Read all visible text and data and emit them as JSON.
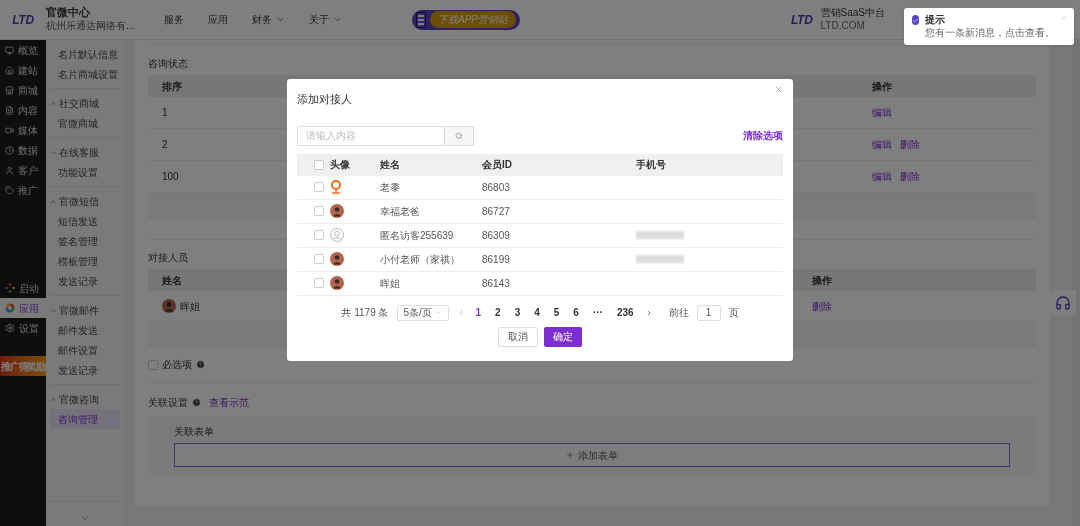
{
  "topbar": {
    "logo": "LTD",
    "title": "官微中心",
    "subtitle": "杭州乐通达网络有...",
    "nav": [
      {
        "label": "服务",
        "dropdown": false
      },
      {
        "label": "应用",
        "dropdown": false
      },
      {
        "label": "财务",
        "dropdown": true
      },
      {
        "label": "关于",
        "dropdown": true
      }
    ],
    "banner": "下载APP营销站",
    "brand": {
      "logo": "LTD",
      "name": "营销SaaS中台",
      "domain": "LTD.COM"
    }
  },
  "main_nav": [
    {
      "label": "概览",
      "selected": false
    },
    {
      "label": "建站",
      "selected": false
    },
    {
      "label": "商城",
      "selected": false
    },
    {
      "label": "内容",
      "selected": false
    },
    {
      "label": "媒体",
      "selected": false
    },
    {
      "label": "数据",
      "selected": false
    },
    {
      "label": "客户",
      "selected": false
    },
    {
      "label": "推广",
      "selected": false
    }
  ],
  "main_nav_bottom": [
    {
      "label": "启动",
      "selected": false
    },
    {
      "label": "应用",
      "selected": true
    },
    {
      "label": "设置",
      "selected": false
    }
  ],
  "promo": "推广得奖励",
  "sub_nav": [
    {
      "items": [
        {
          "label": "名片默认信息",
          "selected": false
        },
        {
          "label": "名片商城设置",
          "selected": false
        }
      ]
    },
    {
      "title": "社交商城",
      "expanded": true,
      "items": [
        {
          "label": "官微商城",
          "selected": false
        }
      ]
    },
    {
      "title": "在线客服",
      "expanded": true,
      "items": [
        {
          "label": "功能设置",
          "selected": false
        }
      ]
    },
    {
      "title": "官微短信",
      "expanded": true,
      "items": [
        {
          "label": "短信发送",
          "selected": false
        },
        {
          "label": "签名管理",
          "selected": false
        },
        {
          "label": "模板管理",
          "selected": false
        },
        {
          "label": "发送记录",
          "selected": false
        }
      ]
    },
    {
      "title": "官微邮件",
      "expanded": true,
      "items": [
        {
          "label": "邮件发送",
          "selected": false
        },
        {
          "label": "邮件设置",
          "selected": false
        },
        {
          "label": "发送记录",
          "selected": false
        }
      ]
    },
    {
      "title": "官微咨询",
      "expanded": true,
      "items": [
        {
          "label": "咨询管理",
          "selected": true
        }
      ]
    }
  ],
  "status_section": {
    "title": "咨询状态",
    "columns": [
      "排序",
      "操作"
    ],
    "rows": [
      {
        "order": "1",
        "actions": [
          "编辑"
        ]
      },
      {
        "order": "2",
        "actions": [
          "编辑",
          "删除"
        ]
      },
      {
        "order": "100",
        "actions": [
          "编辑",
          "删除"
        ]
      }
    ]
  },
  "contacts_section": {
    "title": "对接人员",
    "columns": [
      "姓名",
      "操作"
    ],
    "rows": [
      {
        "name": "晖姐",
        "actions": [
          "删除"
        ]
      }
    ]
  },
  "required": {
    "label": "必选项",
    "checked": false
  },
  "link_settings": {
    "title": "关联设置",
    "example_link": "查看示范",
    "form_label": "关联表单",
    "add_button": "添加表单"
  },
  "dialog": {
    "title": "添加对接人",
    "search_placeholder": "请输入内容",
    "clear_link": "清除选项",
    "all_checked": false,
    "columns": [
      "头像",
      "姓名",
      "会员ID",
      "手机号"
    ],
    "rows": [
      {
        "kind": "pin",
        "name": "老黍",
        "id": "86803",
        "checked": false,
        "phone_blurred": false
      },
      {
        "kind": "photo",
        "name": "幸福老爸",
        "id": "86727",
        "checked": false,
        "phone_blurred": false
      },
      {
        "kind": "default",
        "name": "匿名访客255639",
        "id": "86309",
        "checked": false,
        "phone_blurred": true
      },
      {
        "kind": "photo",
        "name": "小付老师（家祺）",
        "id": "86199",
        "checked": false,
        "phone_blurred": true
      },
      {
        "kind": "photo",
        "name": "晖姐",
        "id": "86143",
        "checked": false,
        "phone_blurred": false
      }
    ],
    "pagination": {
      "total": "共 1179 条",
      "page_size": "5条/页",
      "pages": [
        {
          "label": "1",
          "selected": true
        },
        {
          "label": "2",
          "selected": false
        },
        {
          "label": "3",
          "selected": false
        },
        {
          "label": "4",
          "selected": false
        },
        {
          "label": "5",
          "selected": false
        },
        {
          "label": "6",
          "selected": false
        },
        {
          "label": "···",
          "selected": false
        },
        {
          "label": "236",
          "selected": false
        }
      ],
      "goto_label": "前往",
      "goto_value": "1",
      "goto_unit": "页"
    },
    "buttons": [
      {
        "label": "取消",
        "kind": "secondary"
      },
      {
        "label": "确定",
        "kind": "primary"
      }
    ]
  },
  "notification": {
    "title": "提示",
    "message": "您有一条新消息，点击查看。"
  }
}
